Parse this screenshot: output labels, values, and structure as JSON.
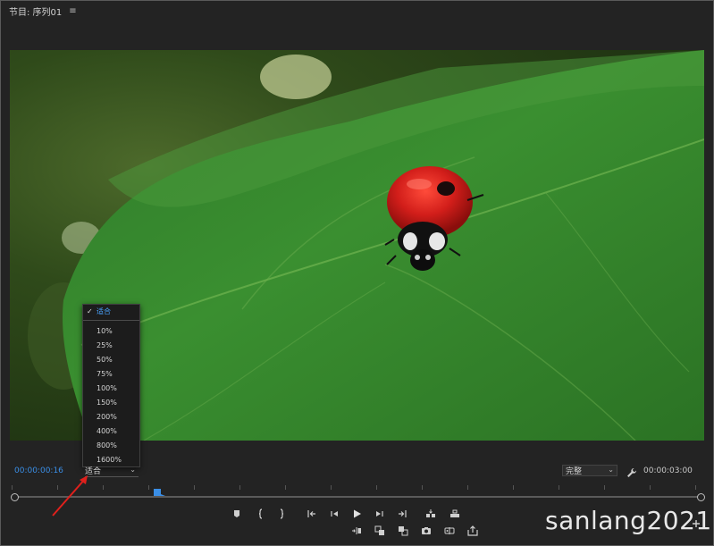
{
  "panel": {
    "title": "节目: 序列01",
    "menu_icon": "hamburger-menu-icon"
  },
  "viewer": {
    "image_description": "close-up of a red ladybug on a green leaf"
  },
  "zoom_menu": {
    "selected": "适合",
    "options": [
      "10%",
      "25%",
      "50%",
      "75%",
      "100%",
      "150%",
      "200%",
      "400%",
      "800%",
      "1600%"
    ]
  },
  "bottom_bar": {
    "current_timecode": "00:00:00:16",
    "fit_label": "适合",
    "resolution_label": "完整",
    "duration_timecode": "00:00:03:00",
    "settings_icon": "wrench-icon"
  },
  "transport_row1": [
    {
      "name": "add-marker-button",
      "icon": "marker-icon"
    },
    {
      "name": "mark-in-button",
      "icon": "mark-in-icon"
    },
    {
      "name": "mark-out-button",
      "icon": "mark-out-icon"
    },
    {
      "name": "go-to-in-button",
      "icon": "go-to-in-icon"
    },
    {
      "name": "step-back-button",
      "icon": "step-back-icon"
    },
    {
      "name": "play-button",
      "icon": "play-icon"
    },
    {
      "name": "step-forward-button",
      "icon": "step-forward-icon"
    },
    {
      "name": "go-to-out-button",
      "icon": "go-to-out-icon"
    },
    {
      "name": "insert-button",
      "icon": "insert-icon"
    },
    {
      "name": "overwrite-button",
      "icon": "overwrite-icon"
    }
  ],
  "transport_row2": [
    {
      "name": "trim-button",
      "icon": "trim-icon"
    },
    {
      "name": "lift-button",
      "icon": "lift-icon"
    },
    {
      "name": "extract-button",
      "icon": "extract-icon"
    },
    {
      "name": "export-frame-button",
      "icon": "camera-icon"
    },
    {
      "name": "comparison-view-button",
      "icon": "comparison-icon"
    },
    {
      "name": "export-button",
      "icon": "share-icon"
    }
  ],
  "watermark": "sanlang2021",
  "colors": {
    "background": "#232323",
    "timecode_accent": "#3a8ee6",
    "selected_item": "#4aa3ff",
    "playhead": "#3a8ee6",
    "annotation_arrow": "#e0201c"
  }
}
